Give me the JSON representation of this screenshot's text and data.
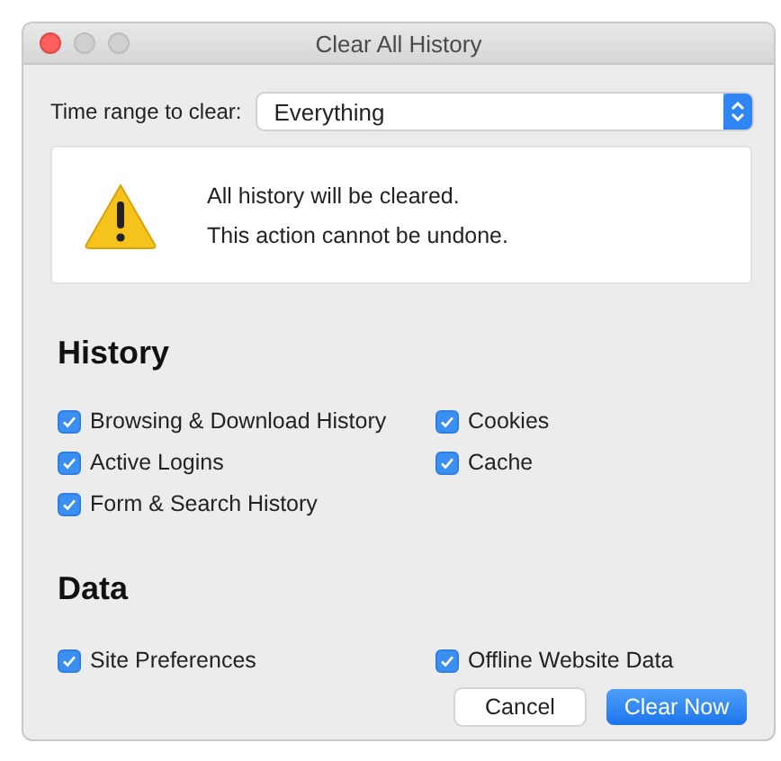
{
  "window": {
    "title": "Clear All History"
  },
  "time_range": {
    "label": "Time range to clear:",
    "value": "Everything"
  },
  "warning": {
    "lines": [
      "All history will be cleared.",
      "This action cannot be undone."
    ]
  },
  "sections": [
    {
      "heading": "History",
      "options": [
        {
          "label": "Browsing & Download History",
          "checked": true
        },
        {
          "label": "Cookies",
          "checked": true
        },
        {
          "label": "Active Logins",
          "checked": true
        },
        {
          "label": "Cache",
          "checked": true
        },
        {
          "label": "Form & Search History",
          "checked": true
        }
      ]
    },
    {
      "heading": "Data",
      "options": [
        {
          "label": "Site Preferences",
          "checked": true
        },
        {
          "label": "Offline Website Data",
          "checked": true
        }
      ]
    }
  ],
  "buttons": [
    {
      "label": "Cancel",
      "kind": "secondary"
    },
    {
      "label": "Clear Now",
      "kind": "primary"
    }
  ]
}
